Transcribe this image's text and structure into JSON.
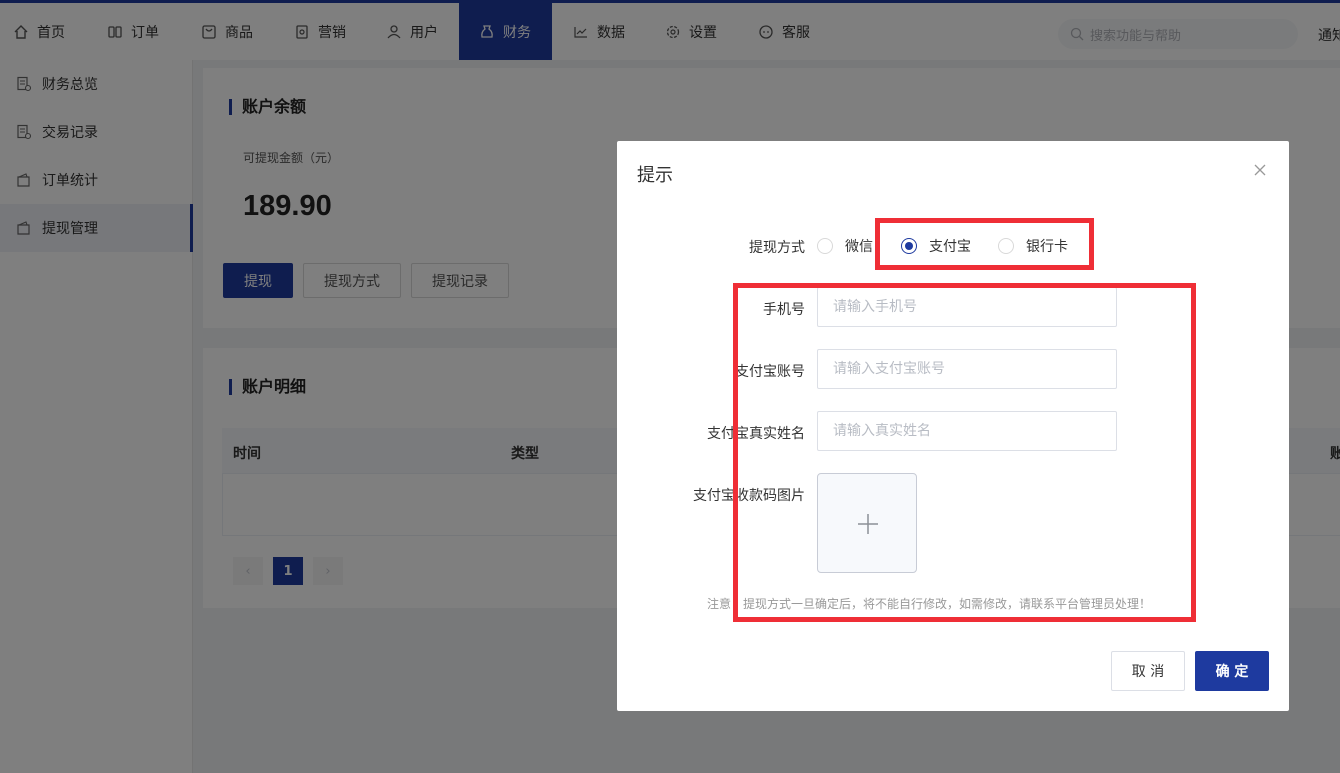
{
  "nav": {
    "items": [
      {
        "label": "首页",
        "icon": "home-icon"
      },
      {
        "label": "订单",
        "icon": "order-icon"
      },
      {
        "label": "商品",
        "icon": "goods-icon"
      },
      {
        "label": "营销",
        "icon": "marketing-icon"
      },
      {
        "label": "用户",
        "icon": "user-icon"
      },
      {
        "label": "财务",
        "icon": "finance-icon"
      },
      {
        "label": "数据",
        "icon": "chart-icon"
      },
      {
        "label": "设置",
        "icon": "gear-icon"
      },
      {
        "label": "客服",
        "icon": "chat-icon"
      }
    ],
    "active": "财务",
    "search_placeholder": "搜索功能与帮助",
    "notice_label": "通知"
  },
  "sidebar": {
    "items": [
      {
        "label": "财务总览"
      },
      {
        "label": "交易记录"
      },
      {
        "label": "订单统计"
      },
      {
        "label": "提现管理"
      }
    ],
    "active": "提现管理"
  },
  "balance": {
    "title": "账户余额",
    "sub_label": "可提现金额（元）",
    "amount": "189.90",
    "buttons": {
      "withdraw": "提现",
      "method": "提现方式",
      "records": "提现记录"
    }
  },
  "detail": {
    "title": "账户明细",
    "columns": [
      "时间",
      "类型",
      "账"
    ],
    "pager": {
      "current": "1",
      "prev": "‹",
      "next": "›"
    }
  },
  "dialog": {
    "title": "提示",
    "method_label": "提现方式",
    "methods": [
      "微信",
      "支付宝",
      "银行卡"
    ],
    "selected_method": "支付宝",
    "fields": {
      "phone_label": "手机号",
      "phone_placeholder": "请输入手机号",
      "account_label": "支付宝账号",
      "account_placeholder": "请输入支付宝账号",
      "name_label": "支付宝真实姓名",
      "name_placeholder": "请输入真实姓名",
      "qr_label": "支付宝收款码图片"
    },
    "note": "注意：提现方式一旦确定后，将不能自行修改，如需修改，请联系平台管理员处理！",
    "cancel_label": "取 消",
    "confirm_label": "确 定"
  },
  "colors": {
    "primary": "#1e3a9f",
    "highlight": "#ef2e36"
  }
}
